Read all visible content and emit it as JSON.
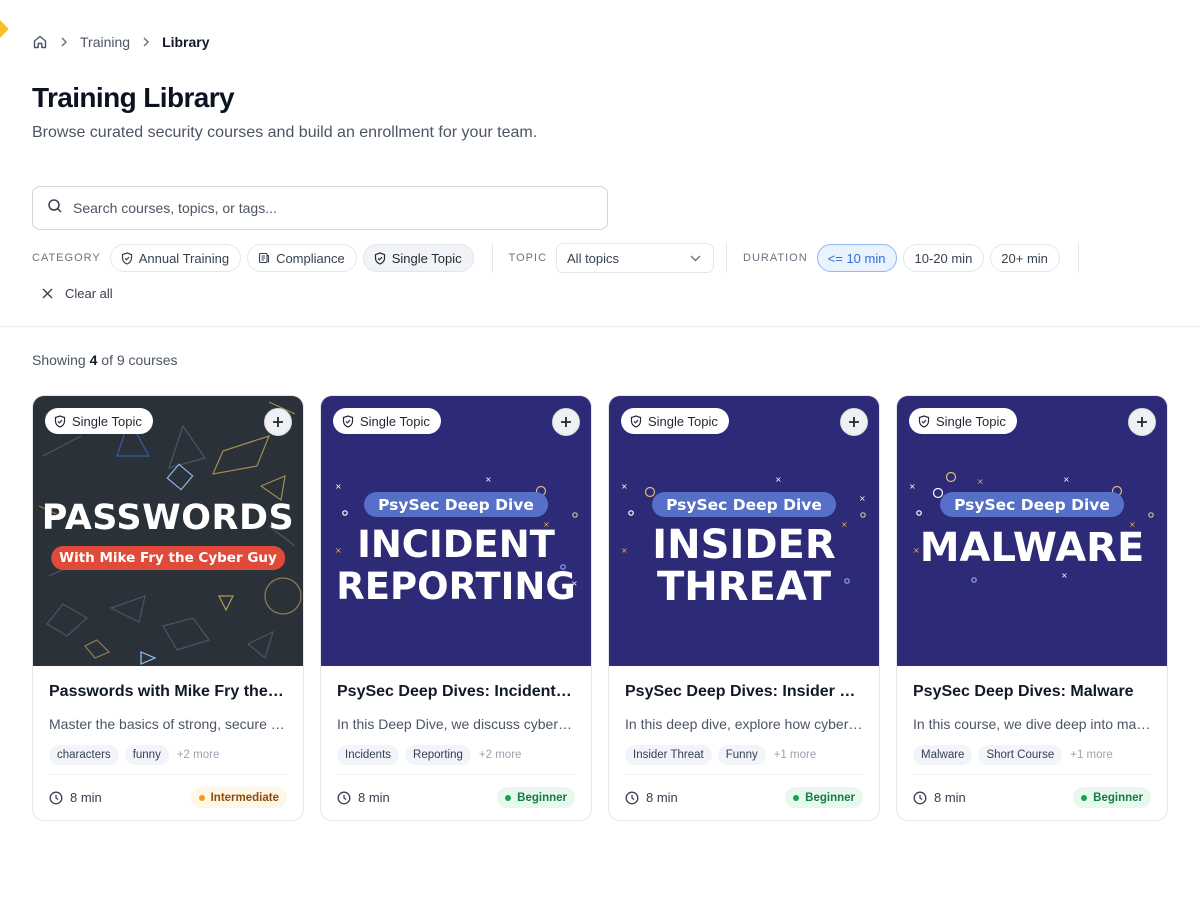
{
  "breadcrumb": {
    "items": [
      "Training",
      "Library"
    ]
  },
  "page": {
    "title": "Training Library",
    "subtitle": "Browse curated security courses and build an enrollment for your team."
  },
  "search": {
    "placeholder": "Search courses, topics, or tags...",
    "value": ""
  },
  "filters": {
    "category_label": "CATEGORY",
    "categories": [
      {
        "label": "Annual Training",
        "icon": "shield-icon",
        "selected": false
      },
      {
        "label": "Compliance",
        "icon": "scroll-icon",
        "selected": false
      },
      {
        "label": "Single Topic",
        "icon": "shield-icon",
        "selected": true
      }
    ],
    "topic_label": "TOPIC",
    "topic_value": "All topics",
    "duration_label": "DURATION",
    "durations": [
      {
        "label": "<= 10 min",
        "selected": true
      },
      {
        "label": "10-20 min",
        "selected": false
      },
      {
        "label": "20+ min",
        "selected": false
      }
    ],
    "clear_all": "Clear all"
  },
  "results": {
    "prefix": "Showing ",
    "shown": "4",
    "suffix": " of 9 courses"
  },
  "colors": {
    "accent_blue": "#2f6fde",
    "brand_yellow": "#fbbf24",
    "navy_thumb": "#2d2a78",
    "dark_thumb": "#2a3138",
    "beginner": "#16a34a",
    "intermediate": "#f59e0b"
  },
  "courses": [
    {
      "badge": "Single Topic",
      "art": {
        "line1": "PASSWORDS",
        "subtitle": "With Mike Fry the Cyber Guy"
      },
      "title": "Passwords with Mike Fry the Cyber Guy",
      "description": "Master the basics of strong, secure passwords.",
      "tags": [
        "characters",
        "funny"
      ],
      "more_tags": "+2 more",
      "duration": "8 min",
      "level": "Intermediate"
    },
    {
      "badge": "Single Topic",
      "art": {
        "series": "PsySec Deep Dive",
        "line1": "INCIDENT",
        "line2": "REPORTING"
      },
      "title": "PsySec Deep Dives: Incident Reporting",
      "description": "In this Deep Dive, we discuss cyber incidents.",
      "tags": [
        "Incidents",
        "Reporting"
      ],
      "more_tags": "+2 more",
      "duration": "8 min",
      "level": "Beginner"
    },
    {
      "badge": "Single Topic",
      "art": {
        "series": "PsySec Deep Dive",
        "line1": "INSIDER",
        "line2": "THREAT"
      },
      "title": "PsySec Deep Dives: Insider Threat",
      "description": "In this deep dive, explore how cyber insiders operate.",
      "tags": [
        "Insider Threat",
        "Funny"
      ],
      "more_tags": "+1 more",
      "duration": "8 min",
      "level": "Beginner"
    },
    {
      "badge": "Single Topic",
      "art": {
        "series": "PsySec Deep Dive",
        "line1": "MALWARE"
      },
      "title": "PsySec Deep Dives: Malware",
      "description": "In this course, we dive deep into malware.",
      "tags": [
        "Malware",
        "Short Course"
      ],
      "more_tags": "+1 more",
      "duration": "8 min",
      "level": "Beginner"
    }
  ]
}
